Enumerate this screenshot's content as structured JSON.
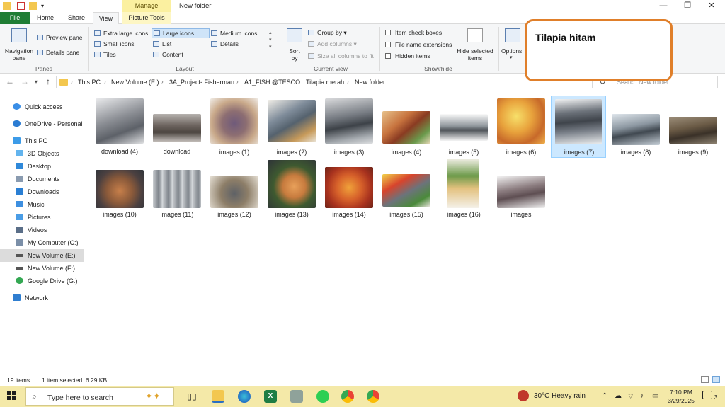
{
  "window": {
    "title": "New folder",
    "contextual_group": "Manage",
    "controls": [
      "—",
      "❐",
      "✕"
    ]
  },
  "ribbon_tabs": {
    "file": "File",
    "home": "Home",
    "share": "Share",
    "view": "View",
    "picture_tools": "Picture Tools"
  },
  "ribbon": {
    "panes": {
      "navigation_pane": "Navigation pane",
      "preview_pane": "Preview pane",
      "details_pane": "Details pane",
      "label": "Panes"
    },
    "layout": {
      "extra_large": "Extra large icons",
      "large": "Large icons",
      "medium": "Medium icons",
      "small": "Small icons",
      "list": "List",
      "details": "Details",
      "tiles": "Tiles",
      "content": "Content",
      "label": "Layout"
    },
    "current_view": {
      "sort_by": "Sort by",
      "group_by": "Group by",
      "add_columns": "Add columns",
      "size_all_columns": "Size all columns to fit",
      "label": "Current view"
    },
    "show_hide": {
      "item_check_boxes": "Item check boxes",
      "file_name_extensions": "File name extensions",
      "hidden_items": "Hidden items",
      "hide_selected": "Hide selected items",
      "label": "Show/hide"
    },
    "options": "Options"
  },
  "annotation": {
    "text": "Tilapia hitam",
    "border_color": "#e07f2a"
  },
  "address": {
    "crumbs": [
      "This PC",
      "New Volume (E:)",
      "3A_Project- Fisherman",
      "A1_FISH @TESCO",
      "Tilapia merah",
      "New folder"
    ],
    "search_placeholder": "Search New folder"
  },
  "sidebar": {
    "items": [
      {
        "label": "Quick access",
        "icon": "star-icon"
      },
      {
        "label": "OneDrive - Personal",
        "icon": "cloud-icon"
      },
      {
        "label": "This PC",
        "icon": "computer-icon"
      },
      {
        "label": "3D Objects",
        "icon": "cube-icon"
      },
      {
        "label": "Desktop",
        "icon": "desktop-icon"
      },
      {
        "label": "Documents",
        "icon": "document-icon"
      },
      {
        "label": "Downloads",
        "icon": "download-icon"
      },
      {
        "label": "Music",
        "icon": "music-icon"
      },
      {
        "label": "Pictures",
        "icon": "pictures-icon"
      },
      {
        "label": "Videos",
        "icon": "video-icon"
      },
      {
        "label": "My Computer (C:)",
        "icon": "drive-icon"
      },
      {
        "label": "New Volume (E:)",
        "icon": "drive-icon"
      },
      {
        "label": "New Volume (F:)",
        "icon": "drive-icon"
      },
      {
        "label": "Google Drive (G:)",
        "icon": "google-drive-icon"
      },
      {
        "label": "Network",
        "icon": "network-icon"
      }
    ]
  },
  "files": [
    {
      "name": "download (4)"
    },
    {
      "name": "download"
    },
    {
      "name": "images (1)"
    },
    {
      "name": "images (2)"
    },
    {
      "name": "images (3)"
    },
    {
      "name": "images (4)"
    },
    {
      "name": "images (5)"
    },
    {
      "name": "images (6)"
    },
    {
      "name": "images (7)",
      "selected": true
    },
    {
      "name": "images (8)"
    },
    {
      "name": "images (9)"
    },
    {
      "name": "images (10)"
    },
    {
      "name": "images (11)"
    },
    {
      "name": "images (12)"
    },
    {
      "name": "images (13)"
    },
    {
      "name": "images (14)"
    },
    {
      "name": "images (15)"
    },
    {
      "name": "images (16)"
    },
    {
      "name": "images"
    }
  ],
  "status": {
    "item_count": "19 items",
    "selection": "1 item selected  6.29 KB"
  },
  "taskbar": {
    "search_placeholder": "Type here to search",
    "weather": "30°C  Heavy rain",
    "time": "7:10 PM",
    "date": "3/29/2025",
    "notification_count": "3"
  }
}
